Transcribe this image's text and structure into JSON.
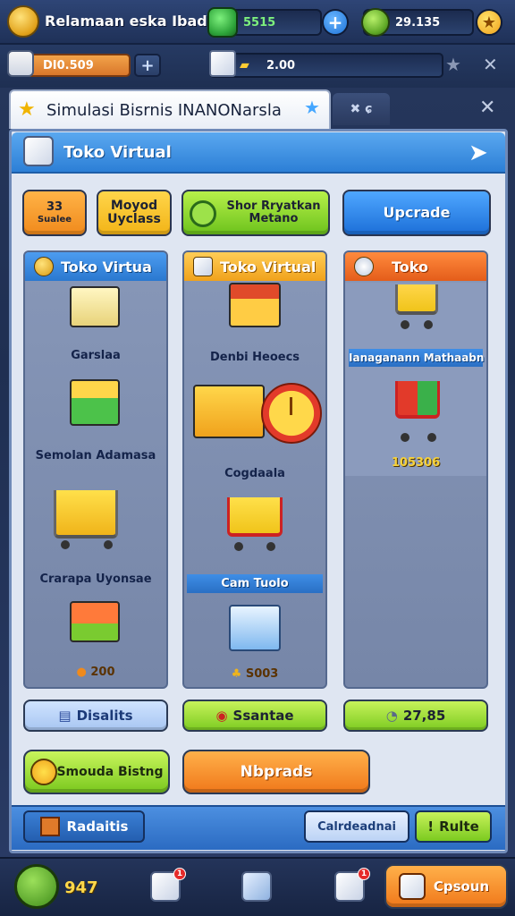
{
  "hud": {
    "title": "Relamaan eska Ibada",
    "gems_value": "5515",
    "coins_value": "29.135",
    "gold_value": "DI0.509",
    "resource_value": "2.00"
  },
  "window": {
    "tab_title": "Simulasi Bisrnis INANONarsla",
    "tab_side_label": "✖ ɕ",
    "panel_title": "Toko Virtual"
  },
  "top_buttons": {
    "btn1_line1": "33",
    "btn1_line2": "Sualee",
    "btn2_line1": "Moyod",
    "btn2_line2": "Uyclass",
    "btn3_line1": "Shor Rryatkan",
    "btn3_line2": "Metano",
    "btn4": "Upcrade"
  },
  "columns": [
    {
      "title": "Toko Virtua",
      "items": [
        "Garslaa",
        "Semolan Adamasa",
        "Crarapa Uyonsae"
      ],
      "price": "200"
    },
    {
      "title": "Toko Virtual",
      "items": [
        "Denbi Heoecs",
        "Cogdaala",
        "Cam Tuolo"
      ],
      "price": "S003"
    },
    {
      "title": "Toko",
      "items": [
        "Ianaganann Mathaabn"
      ],
      "price": "105306"
    }
  ],
  "bottom_buttons": {
    "b1": "Disalits",
    "b2": "Ssantae",
    "b3": "27,85"
  },
  "big_buttons": {
    "green": "Smouda Bistng",
    "orange": "Nbprads"
  },
  "footer": {
    "left": "Radaitis",
    "mid": "Calrdeadnai",
    "right": "Rulte"
  },
  "bottom_nav": {
    "level": "947",
    "badge1": "1",
    "badge2": "1",
    "action": "Cpsoun"
  },
  "colors": {
    "accent_blue": "#2c7fd6",
    "accent_orange": "#f08a1c",
    "accent_green": "#6cc21c"
  }
}
